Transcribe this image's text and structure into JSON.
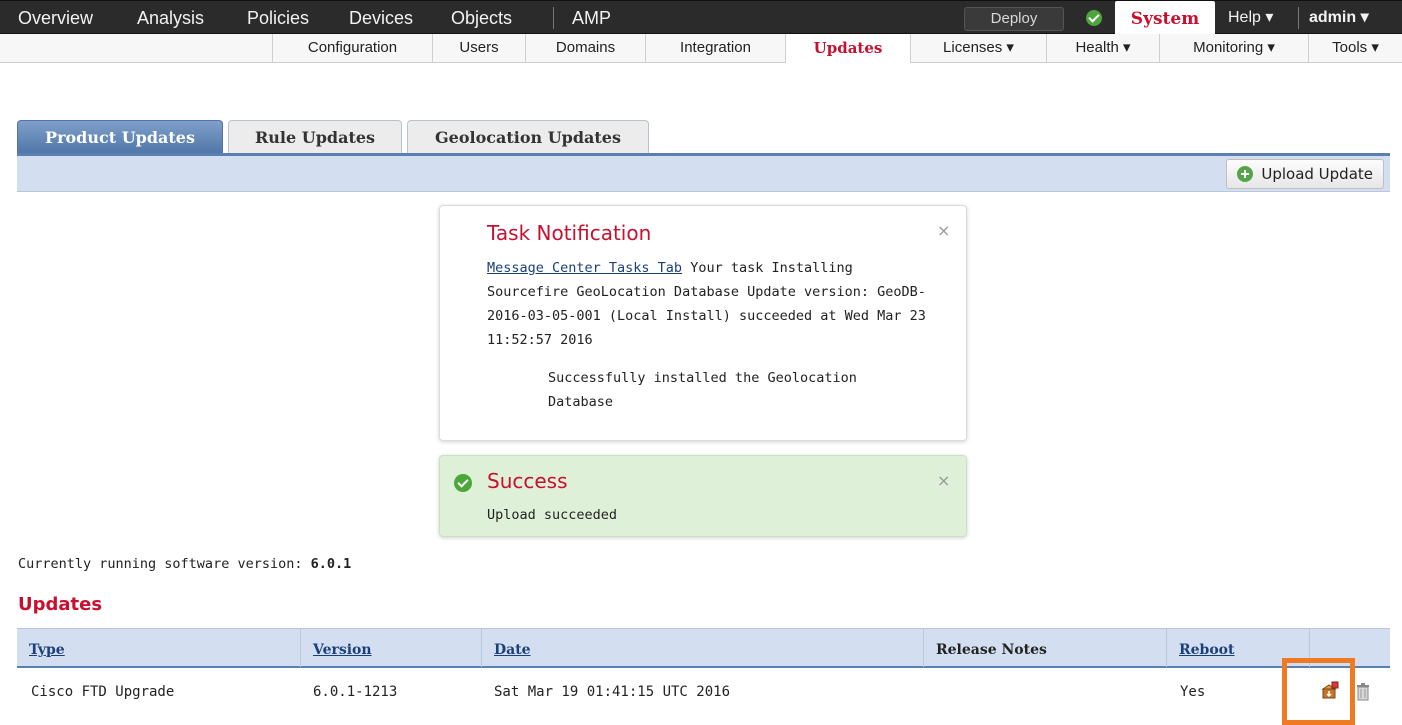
{
  "nav": {
    "primary": [
      "Overview",
      "Analysis",
      "Policies",
      "Devices",
      "Objects",
      "AMP"
    ],
    "deploy_label": "Deploy",
    "status_icon": "check-circle-icon",
    "system_label": "System",
    "help_label": "Help ▾",
    "user_label": "admin ▾"
  },
  "subnav": {
    "items": [
      "Configuration",
      "Users",
      "Domains",
      "Integration",
      "Updates",
      "Licenses ▾",
      "Health ▾",
      "Monitoring ▾",
      "Tools ▾"
    ],
    "active": "Updates"
  },
  "tabs": {
    "items": [
      "Product Updates",
      "Rule Updates",
      "Geolocation Updates"
    ],
    "active": "Product Updates"
  },
  "toolbar": {
    "upload_label": "Upload Update"
  },
  "task_notification": {
    "title": "Task Notification",
    "link_text": "Message Center Tasks Tab",
    "message_rest": " Your task Installing Sourcefire GeoLocation Database Update version: GeoDB-2016-03-05-001 (Local Install) succeeded at Wed Mar 23 11:52:57 2016",
    "detail": "Successfully installed the Geolocation Database",
    "close": "×"
  },
  "success_notification": {
    "title": "Success",
    "message": "Upload succeeded",
    "close": "×"
  },
  "software_version": {
    "label": "Currently running software version:",
    "value": "6.0.1"
  },
  "updates": {
    "title": "Updates",
    "columns": [
      "Type",
      "Version",
      "Date",
      "Release Notes",
      "Reboot"
    ],
    "rows": [
      {
        "type": "Cisco FTD Upgrade",
        "version": "6.0.1-1213",
        "date": "Sat Mar 19 01:41:15 UTC 2016",
        "release_notes": "",
        "reboot": "Yes"
      }
    ]
  },
  "colors": {
    "accent_red": "#c8102e",
    "tab_blue": "#4f76aa",
    "toolbar_blue": "#d3dff0",
    "success_green": "#4ca63c",
    "highlight_orange": "#f07a22"
  }
}
